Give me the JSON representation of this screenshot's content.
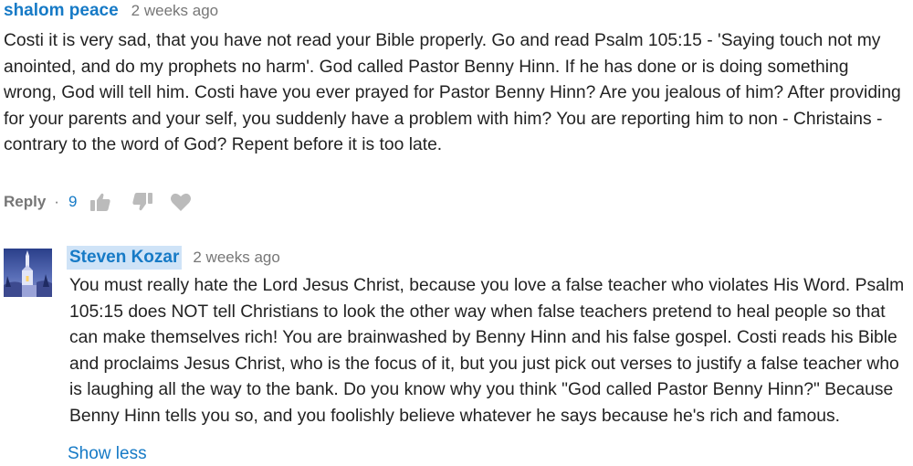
{
  "comments": [
    {
      "author": "shalom peace",
      "time": "2 weeks ago",
      "text": "Costi it is very sad, that you have not read your Bible properly. Go and read Psalm 105:15 - 'Saying touch not my anointed, and do my prophets no harm'. God called Pastor Benny Hinn. If he has done or is doing something wrong, God will tell him. Costi have you ever prayed for Pastor Benny Hinn? Are you jealous of him? After providing for your parents and your self, you suddenly have a problem with him? You are reporting him to non - Christains - contrary to the word of God? Repent before it is too late.",
      "reply_label": "Reply",
      "separator": "·",
      "like_count": "9",
      "icons": [
        "thumbs-up-icon",
        "thumbs-down-icon",
        "heart-icon"
      ]
    },
    {
      "author": "Steven Kozar",
      "time": "2 weeks ago",
      "text": "You must really hate the Lord Jesus Christ, because you love a false teacher who violates His Word. Psalm 105:15 does NOT tell Christians to look the other way when false teachers pretend to heal people so that can make themselves rich! You are brainwashed by Benny Hinn and his false gospel. Costi reads his Bible and proclaims Jesus Christ, who is the focus of it, but you just pick out verses to justify a false teacher who is laughing all the way to the bank. Do you know why you think \"God called Pastor Benny Hinn?\" Because Benny Hinn tells you so, and you foolishly believe whatever he says because he's rich and famous.",
      "show_less_label": "Show less",
      "avatar": "avatar-church-image"
    }
  ],
  "colors": {
    "author": "#167ac6",
    "author_highlight": "#cfe3f7",
    "meta": "#777777",
    "text": "#222222",
    "icon": "#bbbbbb"
  }
}
